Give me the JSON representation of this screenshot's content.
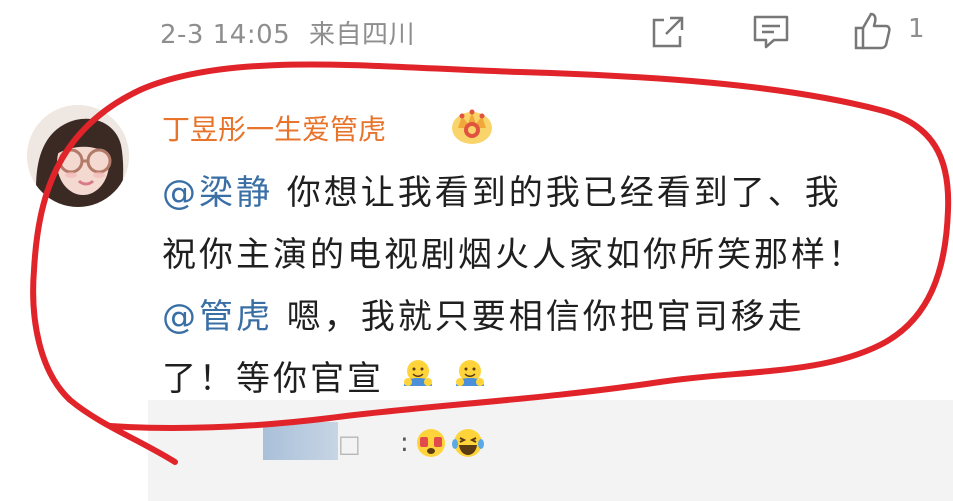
{
  "comment": {
    "timestamp": "2-3 14:05",
    "location": "来自四川",
    "like_count": "1",
    "icons": {
      "share": "share-icon",
      "reply": "comment-icon",
      "like": "thumbs-up-icon",
      "vip_badge": "crown-badge-icon"
    },
    "user": {
      "name": "丁昱彤一生爱管虎"
    },
    "text": {
      "mention1": "@梁静",
      "line1_rest": " 你想让我看到的我已经看到了、我",
      "line2": "祝你主演的电视剧烟火人家如你所笑那样！",
      "mention2": "@管虎",
      "line3_rest": " 嗯，我就只要相信你把官司移走",
      "line4": "了！等你官宣"
    },
    "emojis": [
      "hug-emoji",
      "hug-emoji"
    ]
  },
  "reply": {
    "name_tail": "□",
    "colon": ":",
    "emojis": [
      "surprised-emoji",
      "laughing-tears-emoji"
    ]
  },
  "colors": {
    "username": "#e8742b",
    "mention": "#3a6fa6",
    "annotation": "#e0242a",
    "muted": "#8e8e8e"
  }
}
